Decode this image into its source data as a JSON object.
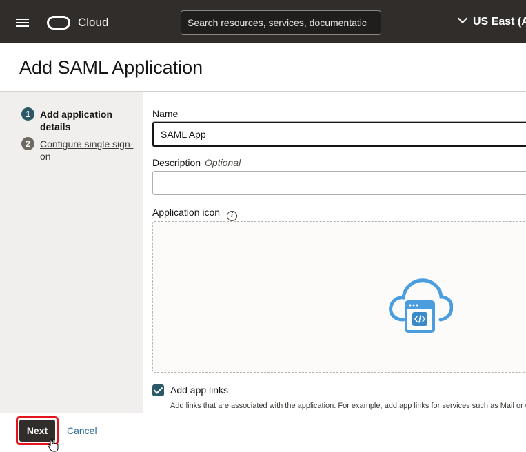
{
  "header": {
    "brand": "Cloud",
    "search_placeholder": "Search resources, services, documentatic",
    "region": "US East (A"
  },
  "page": {
    "title": "Add SAML Application"
  },
  "steps": [
    {
      "number": "1",
      "label": "Add application details"
    },
    {
      "number": "2",
      "label": "Configure single sign-on"
    }
  ],
  "form": {
    "name_label": "Name",
    "name_value": "SAML App",
    "description_label": "Description",
    "description_optional": "Optional",
    "description_value": "",
    "icon_label": "Application icon",
    "info_glyph": "i",
    "add_app_links_label": "Add app links",
    "add_app_links_checked": true,
    "add_app_links_helper": "Add links that are associated with the application. For example, add app links for services such as Mail or C"
  },
  "footer": {
    "next_label": "Next",
    "cancel_label": "Cancel"
  },
  "colors": {
    "header_bg": "#312d2a",
    "step_active": "#2c5967",
    "checkbox": "#2c5967",
    "link": "#2d6a95",
    "highlight": "#e3141b",
    "app_icon": "#4a9ee0"
  }
}
